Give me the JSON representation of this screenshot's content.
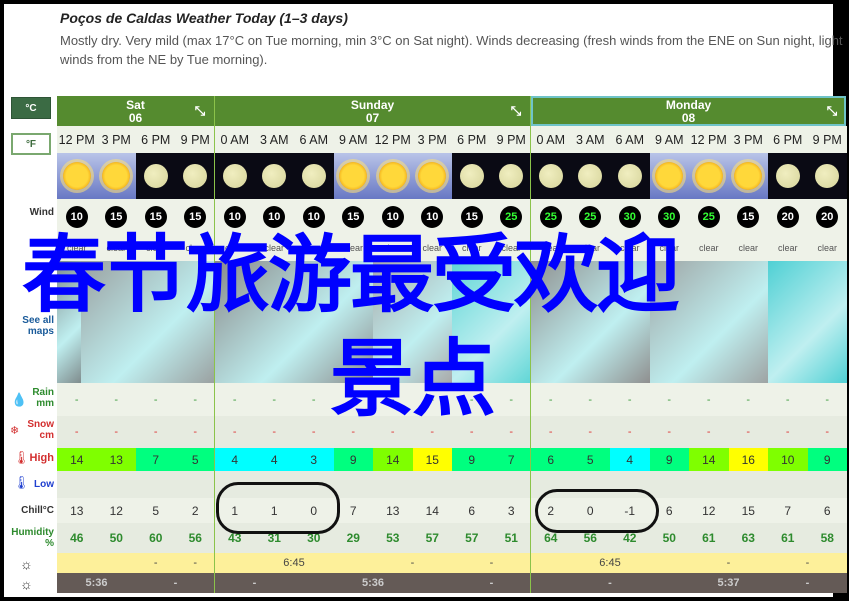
{
  "intro": {
    "title": "Poços de Caldas Weather Today (1–3 days)",
    "line1": "Mostly dry. Very mild (max 17°C on Tue morning, min 3°C on Sat night). Winds decreasing (fresh winds from the ENE on Sun night, light",
    "line2": "winds from the NE by Tue morning)."
  },
  "units": {
    "celsius": "°C",
    "fahrenheit": "°F"
  },
  "legend": {
    "wind": "Wind",
    "see_all_maps": "See all maps",
    "rain": "Rain",
    "rain_unit": "mm",
    "snow": "Snow",
    "snow_unit": "cm",
    "high": "High",
    "low": "Low",
    "chill": "Chill°C",
    "humidity": "Humidity",
    "humidity_unit": "%"
  },
  "days": [
    {
      "name": "Sat",
      "date": "06",
      "selected": false
    },
    {
      "name": "Sunday",
      "date": "07",
      "selected": false
    },
    {
      "name": "Monday",
      "date": "08",
      "selected": true
    }
  ],
  "columns": [
    {
      "hour": "12 PM",
      "sky": "sun",
      "wind": "10",
      "cond": "clear",
      "high": "14",
      "high_color": "#7fff00",
      "chill": "13",
      "hum": "46"
    },
    {
      "hour": "3 PM",
      "sky": "sun",
      "wind": "15",
      "cond": "clear",
      "high": "13",
      "high_color": "#7fff00",
      "chill": "12",
      "hum": "50"
    },
    {
      "hour": "6 PM",
      "sky": "moon",
      "wind": "15",
      "cond": "clear",
      "high": "7",
      "high_color": "#00ff7f",
      "chill": "5",
      "hum": "60"
    },
    {
      "hour": "9 PM",
      "sky": "moon",
      "wind": "15",
      "cond": "clear",
      "high": "5",
      "high_color": "#00ff7f",
      "chill": "2",
      "hum": "56"
    },
    {
      "hour": "0 AM",
      "sky": "moon",
      "wind": "10",
      "cond": "clear",
      "high": "4",
      "high_color": "#00ffff",
      "chill": "1",
      "hum": "43"
    },
    {
      "hour": "3 AM",
      "sky": "moon",
      "wind": "10",
      "cond": "clear",
      "high": "4",
      "high_color": "#00ffff",
      "chill": "1",
      "hum": "31"
    },
    {
      "hour": "6 AM",
      "sky": "moon",
      "wind": "10",
      "cond": "clear",
      "high": "3",
      "high_color": "#00ffff",
      "chill": "0",
      "hum": "30"
    },
    {
      "hour": "9 AM",
      "sky": "sun",
      "wind": "15",
      "cond": "clear",
      "high": "9",
      "high_color": "#00ff7f",
      "chill": "7",
      "hum": "29"
    },
    {
      "hour": "12 PM",
      "sky": "sun",
      "wind": "10",
      "cond": "clear",
      "high": "14",
      "high_color": "#7fff00",
      "chill": "13",
      "hum": "53"
    },
    {
      "hour": "3 PM",
      "sky": "sun",
      "wind": "10",
      "cond": "clear",
      "high": "15",
      "high_color": "#ffff00",
      "chill": "14",
      "hum": "57"
    },
    {
      "hour": "6 PM",
      "sky": "moon",
      "wind": "15",
      "cond": "clear",
      "high": "9",
      "high_color": "#00ff7f",
      "chill": "6",
      "hum": "57"
    },
    {
      "hour": "9 PM",
      "sky": "moon",
      "wind": "25",
      "cond": "clear",
      "high": "7",
      "high_color": "#00ff7f",
      "chill": "3",
      "hum": "51"
    },
    {
      "hour": "0 AM",
      "sky": "moon",
      "wind": "25",
      "cond": "clear",
      "high": "6",
      "high_color": "#00ff7f",
      "chill": "2",
      "hum": "64"
    },
    {
      "hour": "3 AM",
      "sky": "moon",
      "wind": "25",
      "cond": "clear",
      "high": "5",
      "high_color": "#00ff7f",
      "chill": "0",
      "hum": "56"
    },
    {
      "hour": "6 AM",
      "sky": "moon",
      "wind": "30",
      "cond": "clear",
      "high": "4",
      "high_color": "#00ffff",
      "chill": "-1",
      "hum": "42"
    },
    {
      "hour": "9 AM",
      "sky": "sun",
      "wind": "30",
      "cond": "clear",
      "high": "9",
      "high_color": "#00ff7f",
      "chill": "6",
      "hum": "50"
    },
    {
      "hour": "12 PM",
      "sky": "sun",
      "wind": "25",
      "cond": "clear",
      "high": "14",
      "high_color": "#7fff00",
      "chill": "12",
      "hum": "61"
    },
    {
      "hour": "3 PM",
      "sky": "sun",
      "wind": "15",
      "cond": "clear",
      "high": "16",
      "high_color": "#ffff00",
      "chill": "15",
      "hum": "63"
    },
    {
      "hour": "6 PM",
      "sky": "moon",
      "wind": "20",
      "cond": "clear",
      "high": "10",
      "high_color": "#7fff00",
      "chill": "7",
      "hum": "61"
    },
    {
      "hour": "9 PM",
      "sky": "moon",
      "wind": "20",
      "cond": "clear",
      "high": "9",
      "high_color": "#00ff7f",
      "chill": "6",
      "hum": "58"
    }
  ],
  "rain_value": "-",
  "snow_value": "-",
  "sunrise": [
    {
      "span": [
        0,
        2
      ],
      "text": ""
    },
    {
      "span": [
        2,
        3
      ],
      "text": "-"
    },
    {
      "span": [
        3,
        4
      ],
      "text": "-"
    },
    {
      "span": [
        4,
        8
      ],
      "text": "6:45"
    },
    {
      "span": [
        8,
        10
      ],
      "text": "-"
    },
    {
      "span": [
        10,
        12
      ],
      "text": "-"
    },
    {
      "span": [
        12,
        16
      ],
      "text": "6:45"
    },
    {
      "span": [
        16,
        18
      ],
      "text": "-"
    },
    {
      "span": [
        18,
        20
      ],
      "text": "-"
    }
  ],
  "sunset": [
    {
      "span": [
        0,
        2
      ],
      "text": "5:36"
    },
    {
      "span": [
        2,
        4
      ],
      "text": "-"
    },
    {
      "span": [
        4,
        6
      ],
      "text": "-"
    },
    {
      "span": [
        6,
        10
      ],
      "text": "5:36"
    },
    {
      "span": [
        10,
        12
      ],
      "text": "-"
    },
    {
      "span": [
        12,
        16
      ],
      "text": "-"
    },
    {
      "span": [
        16,
        18
      ],
      "text": "5:37"
    },
    {
      "span": [
        18,
        20
      ],
      "text": "-"
    }
  ],
  "overlay": {
    "line1": "春节旅游最受欢迎",
    "line2": "景点"
  },
  "colors": {
    "header_green": "#558b2f",
    "overlay_blue": "#0000ff"
  }
}
